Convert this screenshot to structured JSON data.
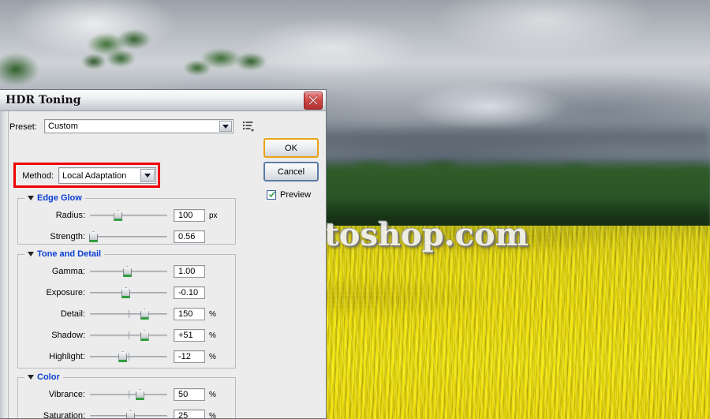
{
  "photo": {
    "description": "Rapeseed field under overcast sky with treeline",
    "watermark": "SoloPhotoshop.com"
  },
  "dialog": {
    "title": "HDR Toning",
    "close_icon": "close-icon",
    "preset": {
      "label": "Preset:",
      "value": "Custom",
      "menu_icon": "preset-options-icon"
    },
    "method": {
      "label": "Method:",
      "value": "Local Adaptation"
    },
    "buttons": {
      "ok": "OK",
      "cancel": "Cancel"
    },
    "preview": {
      "label": "Preview",
      "checked": true
    },
    "groups": [
      {
        "title": "Edge Glow",
        "expanded": true,
        "sliders": [
          {
            "label": "Radius:",
            "value": "100",
            "unit": "px",
            "pos": 36,
            "tick": null
          },
          {
            "label": "Strength:",
            "value": "0.56",
            "unit": "",
            "pos": 4,
            "tick": null
          }
        ]
      },
      {
        "title": "Tone and Detail",
        "expanded": true,
        "sliders": [
          {
            "label": "Gamma:",
            "value": "1.00",
            "unit": "",
            "pos": 48,
            "tick": null
          },
          {
            "label": "Exposure:",
            "value": "-0.10",
            "unit": "",
            "pos": 46,
            "tick": 50
          },
          {
            "label": "Detail:",
            "value": "150",
            "unit": "%",
            "pos": 70,
            "tick": 50
          },
          {
            "label": "Shadow:",
            "value": "+51",
            "unit": "%",
            "pos": 70,
            "tick": 50
          },
          {
            "label": "Highlight:",
            "value": "-12",
            "unit": "%",
            "pos": 42,
            "tick": 50
          }
        ]
      },
      {
        "title": "Color",
        "expanded": true,
        "sliders": [
          {
            "label": "Vibrance:",
            "value": "50",
            "unit": "%",
            "pos": 64,
            "tick": 50
          },
          {
            "label": "Saturation:",
            "value": "25",
            "unit": "%",
            "pos": 52,
            "tick": 50
          }
        ]
      }
    ]
  },
  "colors": {
    "group_title": "#0b3fd4",
    "highlight_box": "#ee0000",
    "slider_accent": "#2f9e3f",
    "ok_border": "#e8a317",
    "cancel_border": "#5b7ba8",
    "dialog_bg": "#ececec"
  }
}
